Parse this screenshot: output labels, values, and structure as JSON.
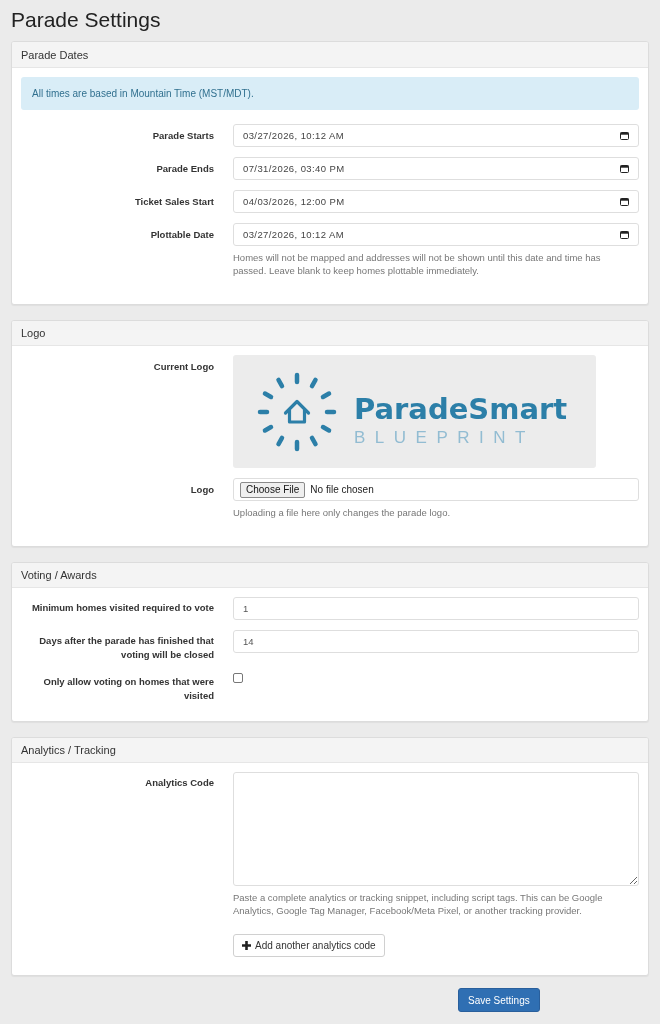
{
  "page_title": "Parade Settings",
  "panels": [
    {
      "title": "Parade Dates",
      "alert": "All times are based in Mountain Time (MST/MDT).",
      "rows": [
        {
          "kind": "datetime",
          "label": "Parade Starts",
          "value": "03/27/2026, 10:12 AM"
        },
        {
          "kind": "datetime",
          "label": "Parade Ends",
          "value": "07/31/2026, 03:40 PM"
        },
        {
          "kind": "datetime",
          "label": "Ticket Sales Start",
          "value": "04/03/2026, 12:00 PM"
        },
        {
          "kind": "datetime",
          "label": "Plottable Date",
          "value": "03/27/2026, 10:12 AM",
          "help": "Homes will not be mapped and addresses will not be shown until this date and time has passed. Leave blank to keep homes plottable immediately."
        }
      ]
    },
    {
      "title": "Logo",
      "rows": [
        {
          "kind": "image",
          "label": "Current Logo",
          "logo": {
            "name": "ParadeSmart",
            "tagline": "BLUEPRINT"
          }
        },
        {
          "kind": "file",
          "label": "Logo",
          "button": "Choose File",
          "status": "No file chosen",
          "help": "Uploading a file here only changes the parade logo."
        }
      ]
    },
    {
      "title": "Voting / Awards",
      "rows": [
        {
          "kind": "number",
          "label": "Minimum homes visited required to vote",
          "value": "1"
        },
        {
          "kind": "number",
          "label": "Days after the parade has finished that voting will be closed",
          "value": "14"
        },
        {
          "kind": "checkbox",
          "label": "Only allow voting on homes that were visited",
          "checked": false
        }
      ]
    },
    {
      "title": "Analytics / Tracking",
      "rows": [
        {
          "kind": "textarea",
          "label": "Analytics Code",
          "help": "Paste a complete analytics or tracking snippet, including script tags. This can be Google Analytics, Google Tag Manager, Facebook/Meta Pixel, or another tracking provider.",
          "action": "Add another analytics code"
        }
      ]
    }
  ],
  "save_button": "Save Settings"
}
